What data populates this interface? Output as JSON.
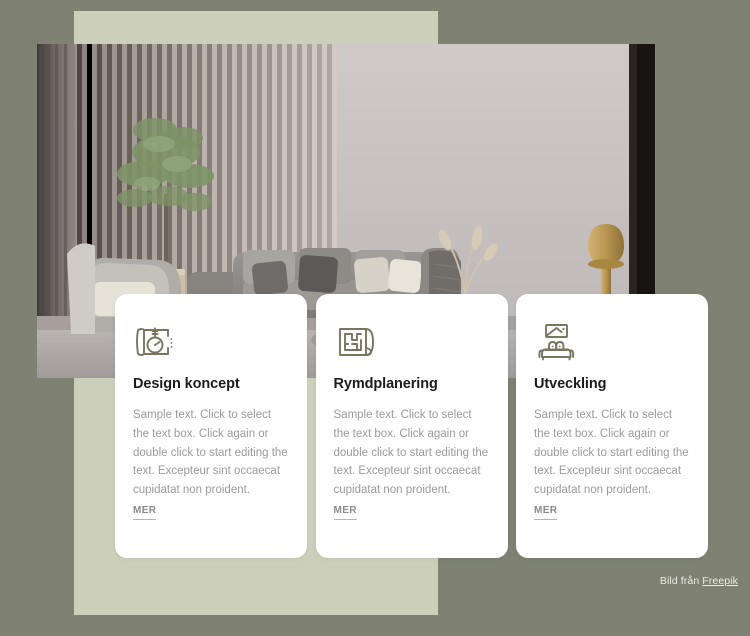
{
  "colors": {
    "outer_background": "#7f8273",
    "panel_background": "#ccd0bb",
    "card_background": "#ffffff",
    "title_text": "#1c1c1c",
    "body_text": "#9a9a9a",
    "link_text": "#8a8a8a",
    "icon_stroke": "#77775f"
  },
  "hero": {
    "alt": "Modern living room with grey sectional sofa, fluted wall panels, potted tree and gold lamp"
  },
  "cards": [
    {
      "icon": "blueprint-compass-icon",
      "title": "Design koncept",
      "body": "Sample text. Click to select the text box. Click again or double click to start editing the\ntext. Excepteur sint occaecat cupidatat non proident.",
      "more_label": "MER"
    },
    {
      "icon": "floor-plan-icon",
      "title": "Rymdplanering",
      "body": "Sample text. Click to select the text box. Click again or double click to start editing the\ntext. Excepteur sint occaecat cupidatat non proident.",
      "more_label": "MER"
    },
    {
      "icon": "sofa-picture-frame-icon",
      "title": "Utveckling",
      "body": "Sample text. Click to select the text box. Click again or double click to start editing the\ntext. Excepteur sint occaecat cupidatat non proident.",
      "more_label": "MER"
    }
  ],
  "attribution": {
    "prefix": "Bild från ",
    "link_label": "Freepik"
  }
}
